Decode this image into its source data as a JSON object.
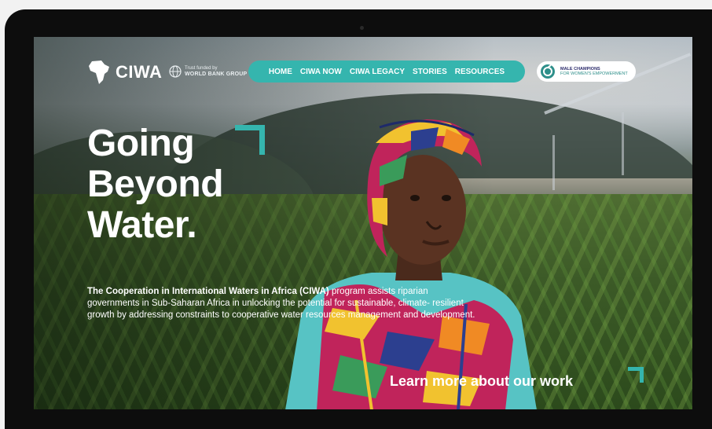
{
  "header": {
    "logo_text": "CIWA",
    "partner_line1": "WORLD BANK GROUP",
    "partner_small": "Trust funded by"
  },
  "nav": {
    "items": [
      {
        "label": "HOME"
      },
      {
        "label": "CIWA NOW"
      },
      {
        "label": "CIWA LEGACY"
      },
      {
        "label": "STORIES"
      },
      {
        "label": "RESOURCES"
      }
    ]
  },
  "badge": {
    "line1": "MALE CHAMPIONS",
    "line2": "FOR WOMEN'S EMPOWERMENT"
  },
  "hero": {
    "title_line1": "Going",
    "title_line2": "Beyond",
    "title_line3": "Water.",
    "desc_bold": "The Cooperation in International Waters in Africa (CIWA)",
    "desc_rest": " program assists riparian governments in Sub-Saharan Africa in unlocking the potential for sustainable, climate- resilient growth by addressing constraints to cooperative water resources management and development.",
    "cta_label": "Learn more about our work"
  },
  "colors": {
    "accent": "#35b5ae",
    "frame": "#0d0d0d",
    "badge_text": "#2b2b6b"
  },
  "icons": {
    "logo": "africa-continent-icon",
    "partner": "globe-icon",
    "badge": "male-champions-icon"
  }
}
